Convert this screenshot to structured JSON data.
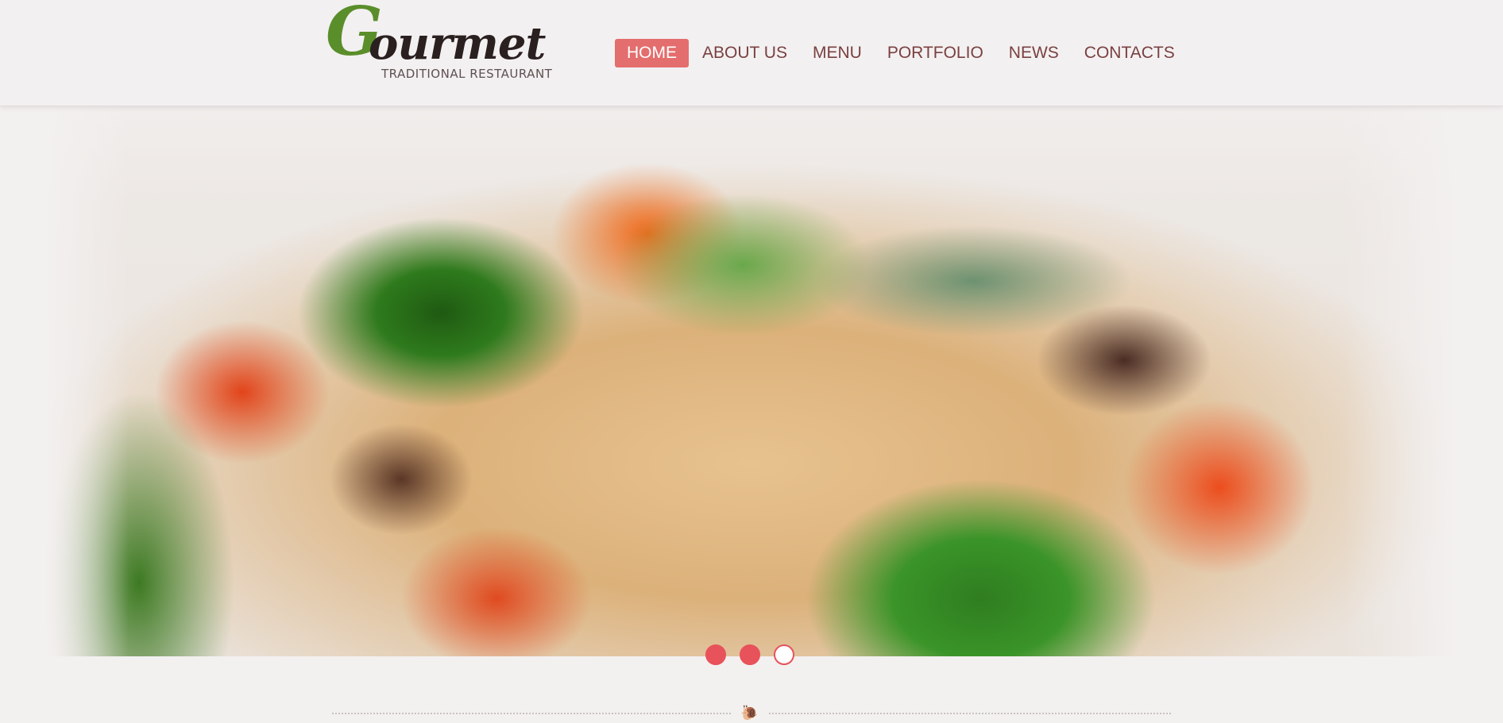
{
  "brand": {
    "logo_initial": "G",
    "logo_rest": "ourmet",
    "tagline": "TRADITIONAL RESTAURANT",
    "accent_color": "#e46d6d",
    "logo_green": "#5a8e2a"
  },
  "nav": {
    "items": [
      {
        "label": "HOME",
        "active": true
      },
      {
        "label": "ABOUT US",
        "active": false
      },
      {
        "label": "MENU",
        "active": false
      },
      {
        "label": "PORTFOLIO",
        "active": false
      },
      {
        "label": "NEWS",
        "active": false
      },
      {
        "label": "CONTACTS",
        "active": false
      }
    ]
  },
  "hero": {
    "image_subject": "vegetable rice dish with broccoli, carrots, mushrooms and herbs",
    "slides": 3,
    "current_slide": 3
  },
  "divider": {
    "icon": "snail-icon"
  }
}
